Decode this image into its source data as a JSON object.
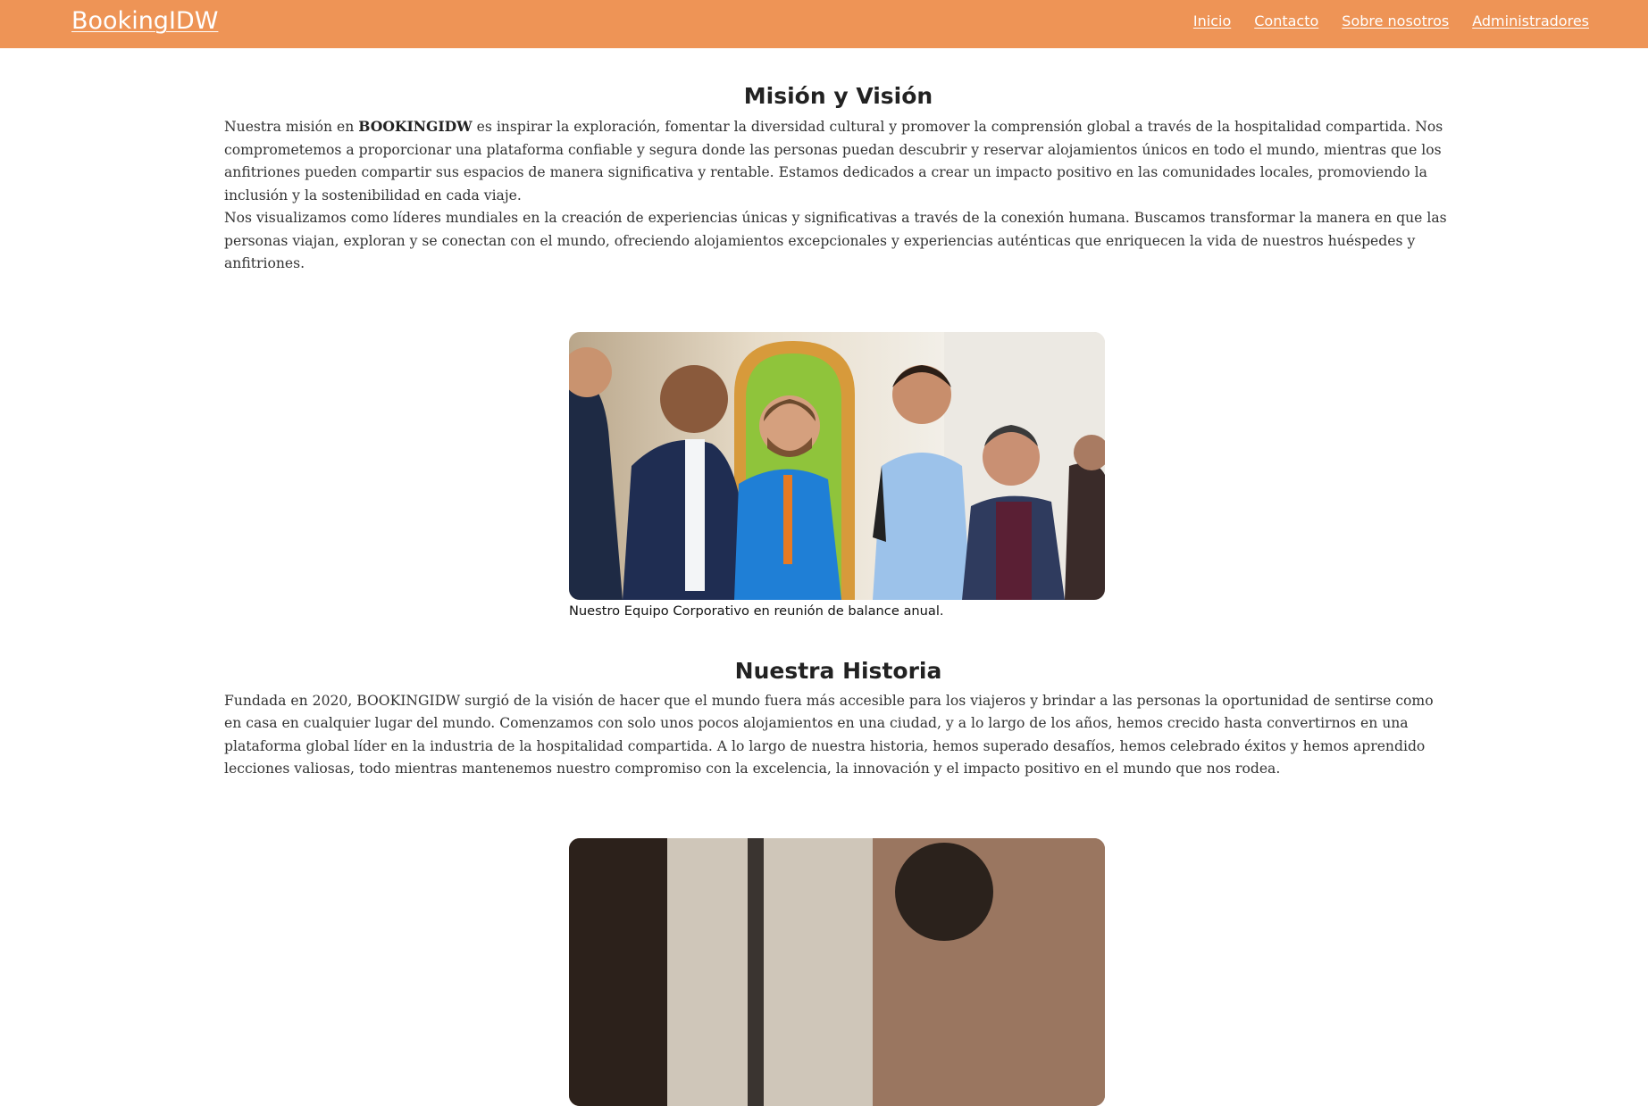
{
  "navbar": {
    "brand": "BookingIDW",
    "links": [
      "Inicio",
      "Contacto",
      "Sobre nosotros",
      "Administradores"
    ]
  },
  "mission": {
    "title": "Misión y Visión",
    "p1_before": "Nuestra misión en ",
    "p1_bold": "BOOKINGIDW",
    "p1_after": " es inspirar la exploración, fomentar la diversidad cultural y promover la comprensión global a través de la hospitalidad compartida. Nos comprometemos a proporcionar una plataforma confiable y segura donde las personas puedan descubrir y reservar alojamientos únicos en todo el mundo, mientras que los anfitriones pueden compartir sus espacios de manera significativa y rentable. Estamos dedicados a crear un impacto positivo en las comunidades locales, promoviendo la inclusión y la sostenibilidad en cada viaje.",
    "p2": "Nos visualizamos como líderes mundiales en la creación de experiencias únicas y significativas a través de la conexión humana. Buscamos transformar la manera en que las personas viajan, exploran y se conectan con el mundo, ofreciendo alojamientos excepcionales y experiencias auténticas que enriquecen la vida de nuestros huéspedes y anfitriones."
  },
  "team_figure": {
    "caption": "Nuestro Equipo Corporativo en reunión de balance anual."
  },
  "history": {
    "title": "Nuestra Historia",
    "p1": "Fundada en 2020, BOOKINGIDW surgió de la visión de hacer que el mundo fuera más accesible para los viajeros y brindar a las personas la oportunidad de sentirse como en casa en cualquier lugar del mundo. Comenzamos con solo unos pocos alojamientos en una ciudad, y a lo largo de los años, hemos crecido hasta convertirnos en una plataforma global líder en la industria de la hospitalidad compartida. A lo largo de nuestra historia, hemos superado desafíos, hemos celebrado éxitos y hemos aprendido lecciones valiosas, todo mientras mantenemos nuestro compromiso con la excelencia, la innovación y el impacto positivo en el mundo que nos rodea."
  },
  "colors": {
    "navbar": "#ee9456",
    "nav_text": "#ffffff",
    "body_text": "#333333"
  }
}
